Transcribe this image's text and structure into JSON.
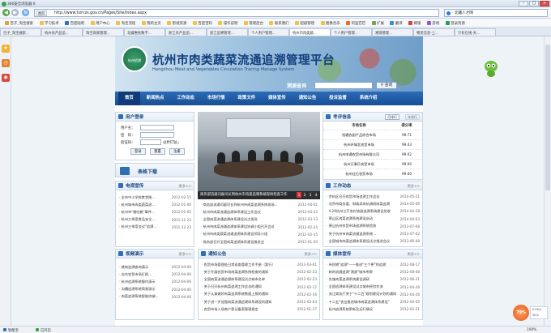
{
  "window": {
    "title": "360安全浏览器 6"
  },
  "address": {
    "protocol_tag": "首页",
    "url": "http://www.hzrczs.gov.cn/Pages/Site/Index.aspx",
    "search_value": "· 北疆人才网"
  },
  "favorites": [
    "百子_淘宝搜索",
    "学习技术",
    "百度贴吧",
    "用户中心",
    "淘宝流程",
    "我的主页",
    "影视资源",
    "百度百科",
    "操作说明",
    "管理后台",
    "联系我们",
    "超级管理",
    "图像音乐",
    "阿里巴巴",
    "扩展",
    "翻译",
    "网银",
    "游戏",
    "登录资源"
  ],
  "tabs": [
    {
      "label": "百子_淘宝搜索..."
    },
    {
      "label": "杭州农产品追..."
    },
    {
      "label": "淘宝商家管理..."
    },
    {
      "label": "北疆惠民数字..."
    },
    {
      "label": "浙江农产品追..."
    },
    {
      "label": "浙江追溯管理..."
    },
    {
      "label": "个人用户管理..."
    },
    {
      "label": "杭州市肉类蔬..."
    },
    {
      "label": "个人用户管理..."
    },
    {
      "label": "溯源管理..."
    },
    {
      "label": "物流信息-上..."
    },
    {
      "label": "只有在线-天..."
    }
  ],
  "site": {
    "title": "杭州市肉类蔬菜流通追溯管理平台",
    "subtitle": "Hangzhou Meat and Vegetables Circulation Tracing Manage System",
    "logo_text": "杭州追溯",
    "query_label": "溯源查询",
    "query_button": "查询"
  },
  "nav": [
    "首页",
    "新闻热点",
    "工作动态",
    "市场行情",
    "政策文件",
    "媒体宣传",
    "通知公告",
    "投诉监督",
    "系统介绍"
  ],
  "login": {
    "title": "用户登录",
    "username_label": "用户名：",
    "password_label": "密　码：",
    "captcha_label": "验证码：",
    "captcha_code": "ㄓ矜钉钛」",
    "buttons": [
      "登录",
      "重置",
      "注册"
    ]
  },
  "download": {
    "title": "表格下载"
  },
  "tech": {
    "title": "电视宣传",
    "more": "更多>>",
    "items": [
      {
        "t": "全市中小学校食堂推...",
        "d": "2012-02-15"
      },
      {
        "t": "杭州城市肉类蔬菜流...",
        "d": "2012-01-06"
      },
      {
        "t": "杭州市\"猪吃粮\"事件...",
        "d": "2012-01-05"
      },
      {
        "t": "杭州三季度食品安全...",
        "d": "2011-11-23"
      },
      {
        "t": "杭州三季度会议\"追溯...",
        "d": "2011-12-22"
      }
    ]
  },
  "video": {
    "title": "视频演示",
    "more": "更多>>",
    "items": [
      {
        "t": "猪肉追溯查询演示",
        "d": "2012-04-06"
      },
      {
        "t": "白鸟农贸市场打假...",
        "d": "2012-04-06"
      },
      {
        "t": "杭州追溯系统操作演示",
        "d": "2012-04-06"
      },
      {
        "t": "沟槽追溯系统简易演示",
        "d": "2012-04-06"
      },
      {
        "t": "肉菜追溯系统智能终端...",
        "d": "2012-04-06"
      }
    ]
  },
  "photo": {
    "caption": "商务部流通司副司长到杭州市肉菜追溯系统现场检查工作",
    "pages": [
      "1",
      "2",
      "3",
      "4"
    ]
  },
  "center_news": {
    "items": [
      {
        "t": "商务部流通司副司长到杭州市肉菜追溯系统现场...",
        "d": "2012-04-01"
      },
      {
        "t": "杭州市肉菜流通追溯体系建设工作会议",
        "d": "2012-03-23"
      },
      {
        "t": "全国肉菜流通追溯体系建设试点现场",
        "d": "2012-03-13"
      },
      {
        "t": "杭州市肉菜流通追溯体系建设协调小组召开会议",
        "d": "2012-02-24"
      },
      {
        "t": "杭州市肉类蔬菜流通追溯体系建设领导小组",
        "d": "2012-02-15"
      },
      {
        "t": "商务部召开全国肉菜追溯体系建设推进会",
        "d": "2012-01-20"
      }
    ]
  },
  "notice": {
    "title": "通知公告",
    "more": "更多>>",
    "items": [
      {
        "t": "农贸市场管理处日常巡查管理工作手册（暂行）",
        "d": "2012-03-01"
      },
      {
        "t": "关于开展农贸市场肉菜追溯系统检查的通知",
        "d": "2012-02-23"
      },
      {
        "t": "全国肉菜流通追溯体系建设试点城市名单",
        "d": "2012-02-23"
      },
      {
        "t": "关于召开杭州肉菜追溯工作会议的通知",
        "d": "2012-02-17"
      },
      {
        "t": "关于认真做好肉菜追溯系统数据上报的通知",
        "d": "2012-02-16"
      },
      {
        "t": "关于进一步加强肉菜流通追溯体系建设的通知",
        "d": "2012-02-03"
      },
      {
        "t": "农贸市场入场商户登记备案管理规定",
        "d": "2012-01-17"
      }
    ]
  },
  "trace": {
    "title": "考评信息",
    "tabs": [
      "月排行",
      "年排行"
    ],
    "headers": [
      "市场名称",
      "得分率"
    ],
    "rows": [
      {
        "name": "钱塘农副产品综合市场",
        "score": "99.71"
      },
      {
        "name": "杭州环城北农贸市场",
        "score": "99.43"
      },
      {
        "name": "杭州申通农贸市场有限公司",
        "score": "99.02"
      },
      {
        "name": "杭州万事乐农贸市场",
        "score": "99.00"
      },
      {
        "name": "杭州红石农贸市场",
        "score": "99.00"
      }
    ]
  },
  "work": {
    "title": "工作动态",
    "more": "更多>>",
    "items": [
      {
        "t": "余杭区召开农贸市场追溯工作会议",
        "d": "2014-05-21"
      },
      {
        "t": "北京市商务委、财政局来杭调研肉菜追溯",
        "d": "2014-05-09"
      },
      {
        "t": "4.26杭州江干农村农副追溯系统建设验收",
        "d": "2014-04-28"
      },
      {
        "t": "萧山区肉菜追溯系统建设启动",
        "d": "2014-04-03"
      },
      {
        "t": "萧山杭州农贸市场追溯系统验收",
        "d": "2013-07-08"
      },
      {
        "t": "关于杭州市肉菜流通追溯系统...",
        "d": "2013-07-02"
      },
      {
        "t": "全国城市肉菜追溯体系建设试点推进会议",
        "d": "2013-06-08"
      }
    ]
  },
  "media": {
    "title": "媒体宣传",
    "more": "更多>>",
    "items": [
      {
        "t": "市民拥\"追溯\"——推进\"三个更\"的追溯",
        "d": "2012-08-17"
      },
      {
        "t": "新的流通追溯\"溯源\"城市考察",
        "d": "2012-08-08"
      },
      {
        "t": "实施肉菜追溯系统建设调研",
        "d": "2012-06-21"
      },
      {
        "t": "全国追溯体系建设试点城市经验交流",
        "d": "2012-04-26"
      },
      {
        "t": "浙江商务厅关于\"十二五\"规划建设计划的通知",
        "d": "2012-04-26"
      },
      {
        "t": "十二五\"农业推进城市肉菜追溯体系建设\"",
        "d": "2012-04-05"
      },
      {
        "t": "杭州追溯系统更新及运行情况",
        "d": "2012-02-21"
      }
    ]
  },
  "status": {
    "left": "智能宝",
    "security": "已开启",
    "zoom": "100%",
    "speed_up": "0.0K/s",
    "speed_down": "0K/s",
    "ball": "79%"
  }
}
